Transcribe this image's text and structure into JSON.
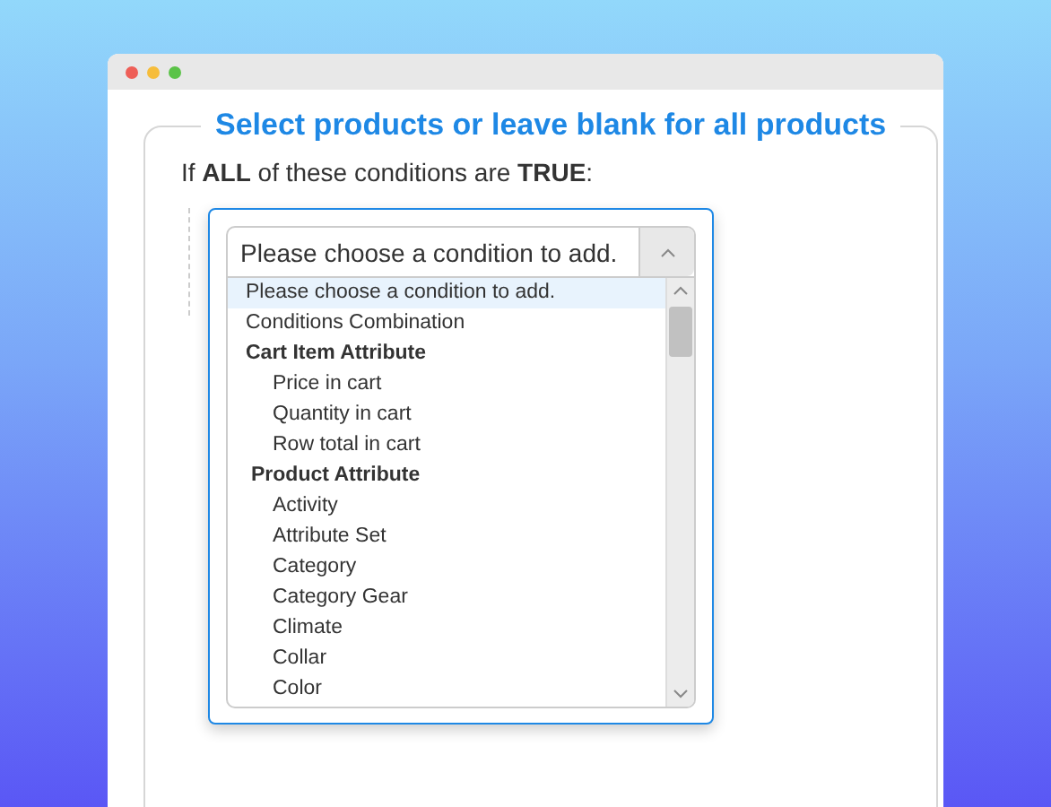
{
  "legend": "Select products or leave blank for all products",
  "rule_text": "If **ALL** of these conditions are **TRUE**:",
  "select": {
    "value": "Please choose a condition to add.",
    "expanded": true
  },
  "options": [
    {
      "kind": "option",
      "label": "Please choose a condition to add.",
      "selected": true
    },
    {
      "kind": "option",
      "label": "Conditions Combination",
      "selected": false
    },
    {
      "kind": "group",
      "label": "Cart Item Attribute",
      "children": [
        {
          "kind": "option",
          "label": "Price in cart",
          "selected": false
        },
        {
          "kind": "option",
          "label": "Quantity in cart",
          "selected": false
        },
        {
          "kind": "option",
          "label": "Row total in cart",
          "selected": false
        }
      ]
    },
    {
      "kind": "group",
      "label": "Product Attribute",
      "children": [
        {
          "kind": "option",
          "label": "Activity",
          "selected": false
        },
        {
          "kind": "option",
          "label": "Attribute Set",
          "selected": false
        },
        {
          "kind": "option",
          "label": "Category",
          "selected": false
        },
        {
          "kind": "option",
          "label": "Category Gear",
          "selected": false
        },
        {
          "kind": "option",
          "label": "Climate",
          "selected": false
        },
        {
          "kind": "option",
          "label": "Collar",
          "selected": false
        },
        {
          "kind": "option",
          "label": "Color",
          "selected": false
        }
      ]
    }
  ]
}
